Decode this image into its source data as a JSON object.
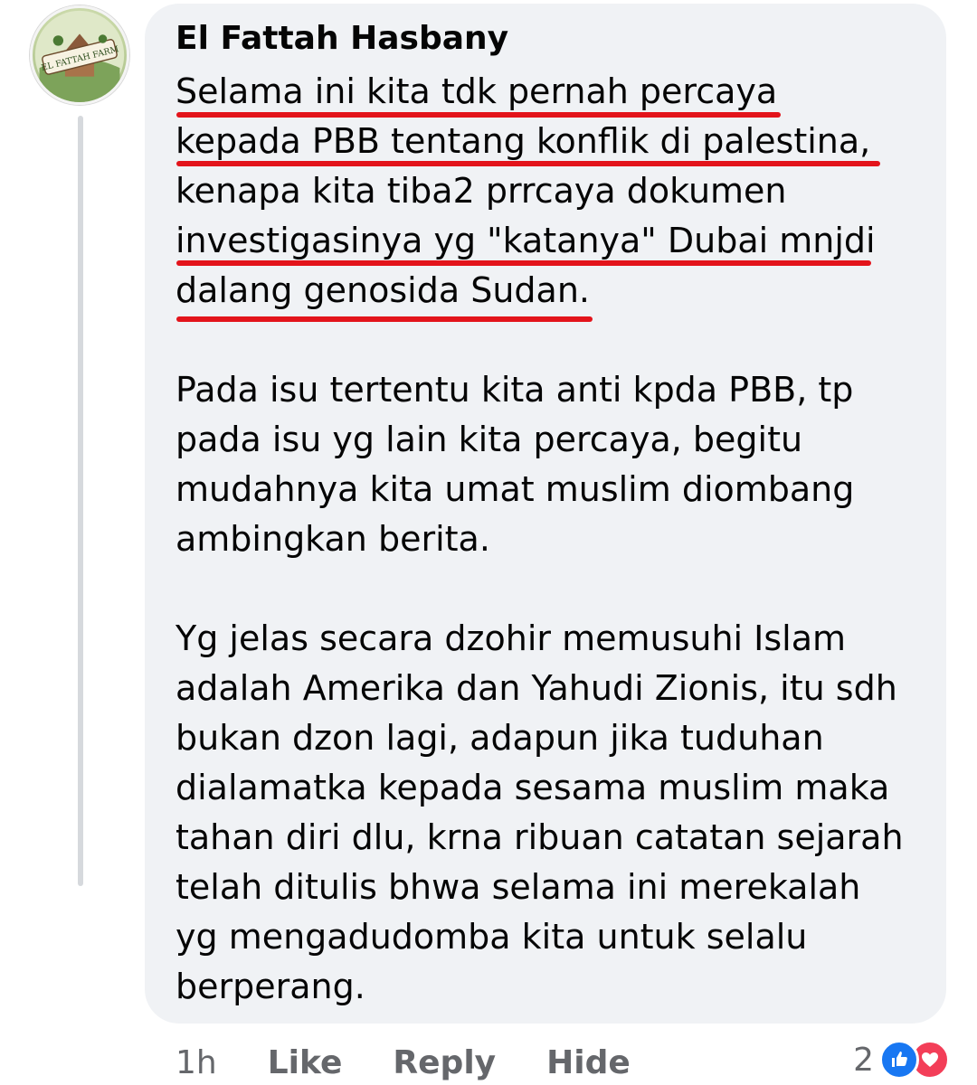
{
  "comment": {
    "author": "El Fattah Hasbany",
    "avatar_label": "EL FATTAH FARM",
    "lines": [
      "Selama ini kita tdk pernah percaya",
      "kepada PBB tentang konflik di palestina,",
      "kenapa kita tiba2 prrcaya dokumen",
      "investigasinya yg \"katanya\" Dubai mnjdi",
      "dalang genosida Sudan.",
      "Pada isu tertentu kita anti kpda PBB, tp",
      "pada isu yg lain kita percaya, begitu",
      "mudahnya kita umat muslim diombang",
      "ambingkan berita.",
      "Yg jelas secara dzohir memusuhi Islam",
      "adalah Amerika dan Yahudi Zionis, itu sdh",
      "bukan dzon lagi, adapun jika tuduhan",
      "dialamatka kepada sesama muslim maka",
      "tahan diri dlu, krna ribuan catatan sejarah",
      "telah ditulis bhwa selama ini merekalah",
      "yg mengadudomba kita untuk selalu",
      "berperang."
    ],
    "underline_color": "#e3141b"
  },
  "actions": {
    "time": "1h",
    "like_label": "Like",
    "reply_label": "Reply",
    "hide_label": "Hide"
  },
  "reactions": {
    "count": "2",
    "icons": [
      "like-icon",
      "love-icon"
    ],
    "like_color": "#1877f2",
    "love_color": "#f33e58"
  }
}
